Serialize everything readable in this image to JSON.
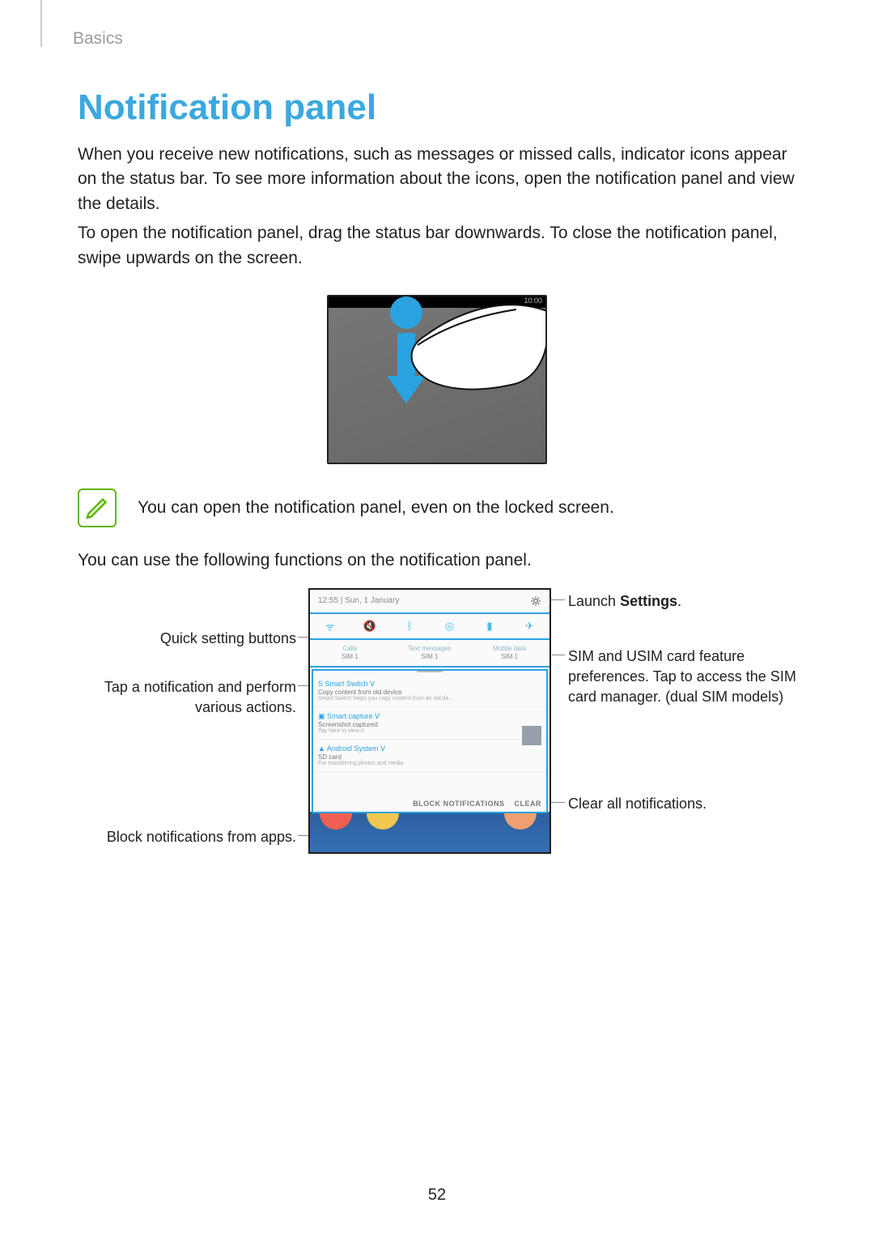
{
  "section": "Basics",
  "title": "Notification panel",
  "para1": "When you receive new notifications, such as messages or missed calls, indicator icons appear on the status bar. To see more information about the icons, open the notification panel and view the details.",
  "para2": "To open the notification panel, drag the status bar downwards. To close the notification panel, swipe upwards on the screen.",
  "illus_time": "10:00",
  "note": "You can open the notification panel, even on the locked screen.",
  "para3": "You can use the following functions on the notification panel.",
  "phone": {
    "date": "12:55 | Sun, 1 January",
    "qs_icons": [
      "wifi-icon",
      "mute-icon",
      "bluetooth-icon",
      "location-icon",
      "flashlight-icon",
      "airplane-icon"
    ],
    "sim": [
      {
        "t": "Calls",
        "b": "SIM 1"
      },
      {
        "t": "Text messages",
        "b": "SIM 1"
      },
      {
        "t": "Mobile data",
        "b": "SIM 1"
      }
    ],
    "notifs": [
      {
        "app": "S  Smart Switch  ᐯ",
        "l1": "Copy content from old device",
        "l2": "Smart Switch helps you copy content from an old de…"
      },
      {
        "app": "▣  Smart capture  ᐯ",
        "l1": "Screenshot captured",
        "l2": "Tap here to view it."
      },
      {
        "app": "▲  Android System  ᐯ",
        "l1": "SD card",
        "l2": "For transferring photos and media"
      }
    ],
    "action_block": "BLOCK NOTIFICATIONS",
    "action_clear": "CLEAR"
  },
  "callouts": {
    "settings_pre": "Launch ",
    "settings_bold": "Settings",
    "settings_post": ".",
    "quick": "Quick setting buttons",
    "sim": "SIM and USIM card feature preferences. Tap to access the SIM card manager. (dual SIM models)",
    "tap": "Tap a notification and perform various actions.",
    "clear": "Clear all notifications.",
    "block": "Block notifications from apps."
  },
  "page_number": "52"
}
